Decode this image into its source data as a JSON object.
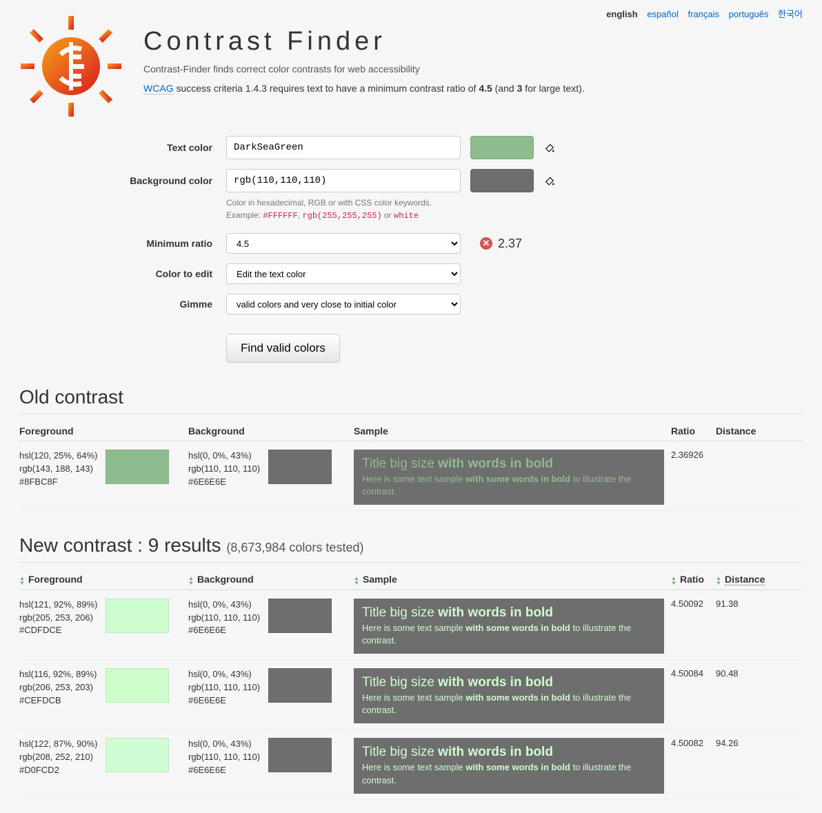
{
  "lang": {
    "english": "english",
    "espanol": "español",
    "francais": "français",
    "portugues": "português",
    "korean": "한국어"
  },
  "header": {
    "title": "Contrast Finder",
    "subtitle": "Contrast-Finder finds correct color contrasts for web accessibility",
    "wcag_link": "WCAG",
    "wcag_text_1": " success criteria 1.4.3 requires text to have a minimum contrast ratio of ",
    "wcag_bold_1": "4.5",
    "wcag_text_2": " (and ",
    "wcag_bold_2": "3",
    "wcag_text_3": " for large text)."
  },
  "form": {
    "text_color_label": "Text color",
    "text_color_value": "DarkSeaGreen",
    "text_swatch": "#8FBC8F",
    "bg_color_label": "Background color",
    "bg_color_value": "rgb(110,110,110)",
    "bg_swatch": "#6E6E6E",
    "help_line1": "Color in hexadecimal, RGB or with CSS color keywords.",
    "help_line2_prefix": "Example: ",
    "help_ex1": "#FFFFFF",
    "help_sep": ", ",
    "help_ex2": "rgb(255,255,255)",
    "help_or": " or ",
    "help_ex3": "white",
    "ratio_label": "Minimum ratio",
    "ratio_value": "4.5",
    "ratio_result": "2.37",
    "edit_label": "Color to edit",
    "edit_value": "Edit the text color",
    "gimme_label": "Gimme",
    "gimme_value": "valid colors and very close to initial color",
    "submit": "Find valid colors"
  },
  "old": {
    "title": "Old contrast",
    "headers": {
      "fg": "Foreground",
      "bg": "Background",
      "sample": "Sample",
      "ratio": "Ratio",
      "dist": "Distance"
    },
    "row": {
      "fg": {
        "hsl": "hsl(120, 25%, 64%)",
        "rgb": "rgb(143, 188, 143)",
        "hex": "#8FBC8F",
        "swatch": "#8FBC8F"
      },
      "bg": {
        "hsl": "hsl(0, 0%, 43%)",
        "rgb": "rgb(110, 110, 110)",
        "hex": "#6E6E6E",
        "swatch": "#6E6E6E"
      },
      "ratio": "2.36926"
    }
  },
  "sample": {
    "title_a": "Title big size ",
    "title_b": "with words in bold",
    "body_a": "Here is some text sample ",
    "body_b": "with some words in bold",
    "body_c": " to illustrate the contrast."
  },
  "new": {
    "title_a": "New contrast : 9 results ",
    "title_b": "(8,673,984 colors tested)",
    "headers": {
      "fg": "Foreground",
      "bg": "Background",
      "sample": "Sample",
      "ratio": "Ratio",
      "dist": "Distance"
    },
    "rows": [
      {
        "fg": {
          "hsl": "hsl(121, 92%, 89%)",
          "rgb": "rgb(205, 253, 206)",
          "hex": "#CDFDCE",
          "swatch": "#CDFDCE"
        },
        "bg": {
          "hsl": "hsl(0, 0%, 43%)",
          "rgb": "rgb(110, 110, 110)",
          "hex": "#6E6E6E",
          "swatch": "#6E6E6E"
        },
        "ratio": "4.50092",
        "dist": "91.38"
      },
      {
        "fg": {
          "hsl": "hsl(116, 92%, 89%)",
          "rgb": "rgb(206, 253, 203)",
          "hex": "#CEFDCB",
          "swatch": "#CEFDCB"
        },
        "bg": {
          "hsl": "hsl(0, 0%, 43%)",
          "rgb": "rgb(110, 110, 110)",
          "hex": "#6E6E6E",
          "swatch": "#6E6E6E"
        },
        "ratio": "4.50084",
        "dist": "90.48"
      },
      {
        "fg": {
          "hsl": "hsl(122, 87%, 90%)",
          "rgb": "rgb(208, 252, 210)",
          "hex": "#D0FCD2",
          "swatch": "#D0FCD2"
        },
        "bg": {
          "hsl": "hsl(0, 0%, 43%)",
          "rgb": "rgb(110, 110, 110)",
          "hex": "#6E6E6E",
          "swatch": "#6E6E6E"
        },
        "ratio": "4.50082",
        "dist": "94.26"
      }
    ]
  }
}
